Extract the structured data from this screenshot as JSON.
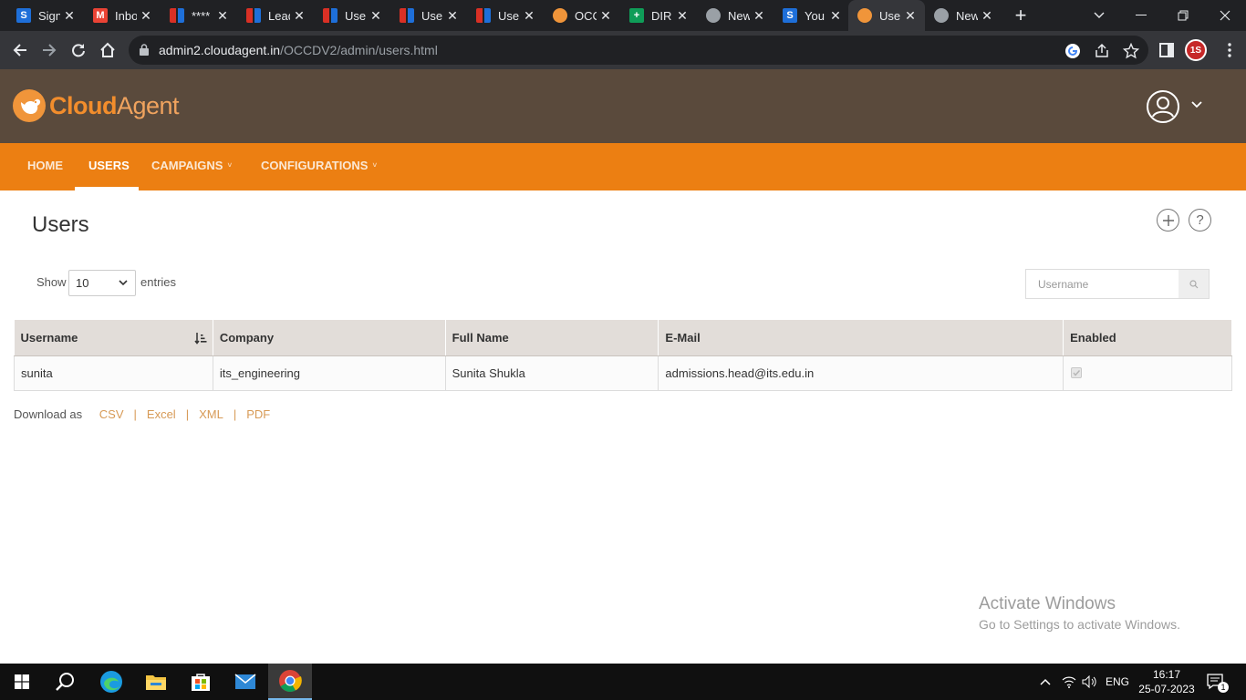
{
  "browser": {
    "tabs": [
      {
        "title": "Sign",
        "favicon": "s-icon",
        "color": "#1e6fd9",
        "letter": "S"
      },
      {
        "title": "Inbox",
        "favicon": "gmail-icon",
        "color": "#ea4335",
        "letter": "M"
      },
      {
        "title": "****",
        "favicon": "bookmark-icon",
        "color": "#d93025",
        "letter": ""
      },
      {
        "title": "Leads",
        "favicon": "bookmark-icon",
        "color": "#d93025",
        "letter": ""
      },
      {
        "title": "Users",
        "favicon": "bookmark-icon",
        "color": "#d93025",
        "letter": ""
      },
      {
        "title": "Users",
        "favicon": "bookmark-icon",
        "color": "#d93025",
        "letter": ""
      },
      {
        "title": "Users",
        "favicon": "bookmark-icon",
        "color": "#d93025",
        "letter": ""
      },
      {
        "title": "OCC",
        "favicon": "cloudagent-icon",
        "color": "#f0953a",
        "letter": ""
      },
      {
        "title": "DIR",
        "favicon": "sheets-icon",
        "color": "#0f9d58",
        "letter": "+"
      },
      {
        "title": "New",
        "favicon": "chrome-icon",
        "color": "#9aa0a6",
        "letter": ""
      },
      {
        "title": "You",
        "favicon": "s-icon",
        "color": "#1e6fd9",
        "letter": "S"
      },
      {
        "title": "Use",
        "favicon": "cloudagent-icon",
        "color": "#f0953a",
        "letter": "",
        "active": true
      },
      {
        "title": "New",
        "favicon": "chrome-icon",
        "color": "#9aa0a6",
        "letter": ""
      }
    ],
    "url_host": "admin2.cloudagent.in",
    "url_path": "/OCCDV2/admin/users.html",
    "profile_initials": "1S"
  },
  "app": {
    "logo_cloud": "Cloud",
    "logo_agent": "Agent"
  },
  "nav": {
    "items": [
      {
        "label": "HOME",
        "active": false,
        "dropdown": false
      },
      {
        "label": "USERS",
        "active": true,
        "dropdown": false
      },
      {
        "label": "CAMPAIGNS",
        "active": false,
        "dropdown": true
      },
      {
        "label": "CONFIGURATIONS",
        "active": false,
        "dropdown": true
      }
    ],
    "caret": "˅"
  },
  "page": {
    "title": "Users",
    "add_glyph": "+",
    "help_glyph": "?"
  },
  "controls": {
    "show_label": "Show",
    "entries_value": "10",
    "entries_label": "entries",
    "search_placeholder": "Username"
  },
  "table": {
    "headers": [
      "Username",
      "Company",
      "Full Name",
      "E-Mail",
      "Enabled"
    ],
    "rows": [
      {
        "username": "sunita",
        "company": "its_engineering",
        "full_name": "Sunita Shukla",
        "email": "admissions.head@its.edu.in",
        "enabled": true
      }
    ]
  },
  "download": {
    "label": "Download as",
    "formats": [
      "CSV",
      "Excel",
      "XML",
      "PDF"
    ],
    "separator": "|"
  },
  "watermark": {
    "line1": "Activate Windows",
    "line2": "Go to Settings to activate Windows."
  },
  "taskbar": {
    "language": "ENG",
    "time": "16:17",
    "date": "25-07-2023",
    "notification_count": "1"
  },
  "colors": {
    "header_bg": "#5a4a3c",
    "nav_bg": "#ec7f12",
    "accent_link": "#d79a56",
    "table_header_bg": "#e2ddd9"
  }
}
